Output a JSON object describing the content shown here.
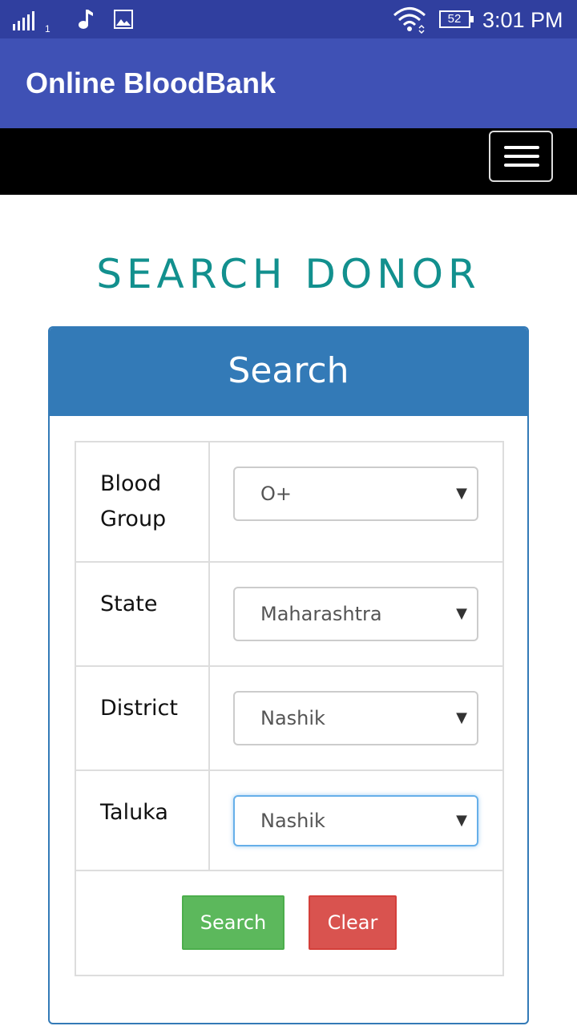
{
  "status_bar": {
    "signal_sim": "1",
    "battery_level": "52",
    "time": "3:01 PM",
    "icons": [
      "signal-icon",
      "music-note-icon",
      "image-icon",
      "wifi-icon",
      "battery-icon"
    ]
  },
  "app_bar": {
    "title": "Online BloodBank"
  },
  "navbar": {
    "menu_icon": "hamburger-menu-icon"
  },
  "heading": "SEARCH DONOR",
  "panel": {
    "title": "Search",
    "fields": [
      {
        "label": "Blood Group",
        "value": "O+"
      },
      {
        "label": "State",
        "value": "Maharashtra"
      },
      {
        "label": "District",
        "value": "Nashik"
      },
      {
        "label": "Taluka",
        "value": "Nashik"
      }
    ],
    "search_label": "Search",
    "clear_label": "Clear"
  },
  "colors": {
    "status_bar": "#303f9f",
    "app_bar": "#3f51b5",
    "heading": "#12908e",
    "panel_primary": "#337ab7",
    "search_button": "#5cb85c",
    "clear_button": "#d9534f"
  }
}
